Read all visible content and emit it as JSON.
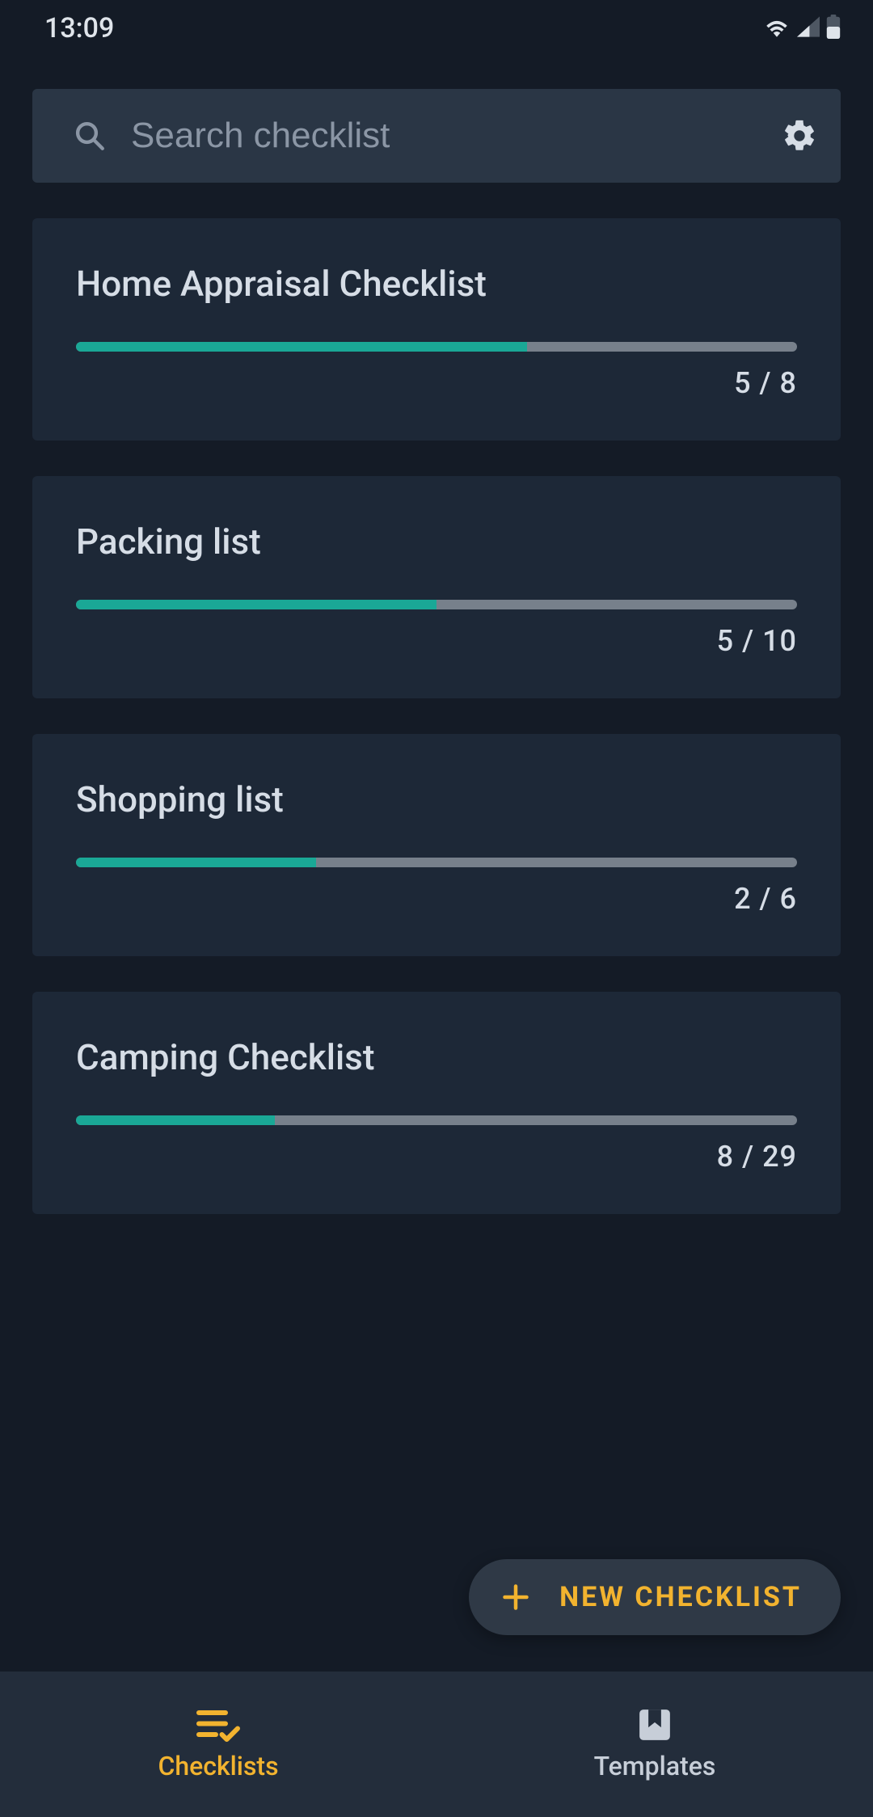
{
  "status": {
    "time": "13:09"
  },
  "search": {
    "placeholder": "Search checklist"
  },
  "checklists": [
    {
      "title": "Home Appraisal Checklist",
      "done": 5,
      "total": 8,
      "label": "5 / 8"
    },
    {
      "title": "Packing list",
      "done": 5,
      "total": 10,
      "label": "5 / 10"
    },
    {
      "title": "Shopping list",
      "done": 2,
      "total": 6,
      "label": "2 / 6"
    },
    {
      "title": "Camping Checklist",
      "done": 8,
      "total": 29,
      "label": "8 / 29"
    }
  ],
  "fab": {
    "label": "NEW CHECKLIST"
  },
  "nav": {
    "checklists": "Checklists",
    "templates": "Templates"
  },
  "colors": {
    "accent": "#f2b32f",
    "progress": "#1aa896"
  }
}
